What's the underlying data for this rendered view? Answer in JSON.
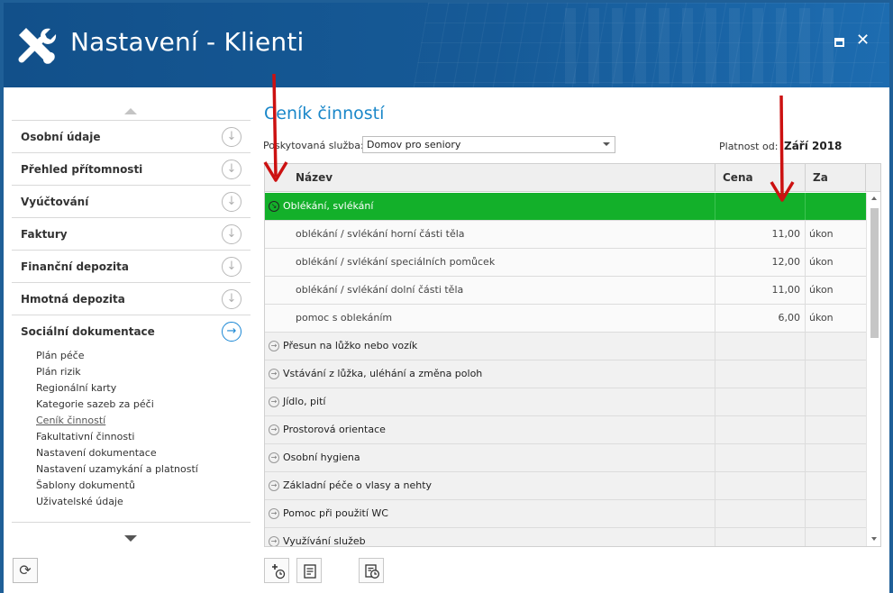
{
  "window": {
    "title": "Nastavení - Klienti",
    "maximize_icon": "maximize-icon",
    "close_label": "✕"
  },
  "sidebar": {
    "items": [
      {
        "label": "Osobní údaje",
        "icon": "circle-arrow-down-icon",
        "active": false
      },
      {
        "label": "Přehled přítomnosti",
        "icon": "circle-arrow-down-icon",
        "active": false
      },
      {
        "label": "Vyúčtování",
        "icon": "circle-arrow-down-icon",
        "active": false
      },
      {
        "label": "Faktury",
        "icon": "circle-arrow-down-icon",
        "active": false
      },
      {
        "label": "Finanční depozita",
        "icon": "circle-arrow-down-icon",
        "active": false
      },
      {
        "label": "Hmotná depozita",
        "icon": "circle-arrow-down-icon",
        "active": false
      },
      {
        "label": "Sociální dokumentace",
        "icon": "circle-arrow-right-icon",
        "active": true
      }
    ],
    "subitems": [
      "Plán péče",
      "Plán rizik",
      "Regionální karty",
      "Kategorie sazeb za péči",
      "Ceník činností",
      "Fakultativní činnosti",
      "Nastavení dokumentace",
      "Nastavení uzamykání a platností",
      "Šablony dokumentů",
      "Uživatelské údaje"
    ],
    "current_subitem": "Ceník činností"
  },
  "main": {
    "title": "Ceník činností",
    "service_label": "Poskytovaná služba:",
    "service_value": "Domov pro seniory",
    "valid_from_label": "Platnost od:",
    "valid_from_value": "Září 2018",
    "columns": {
      "name": "Název",
      "price": "Cena",
      "per": "Za"
    },
    "rows": [
      {
        "type": "category",
        "name": "Oblékání, svlékání",
        "price": "",
        "per": "",
        "selected": true,
        "expanded": true
      },
      {
        "type": "child",
        "name": "oblékání / svlékání horní části těla",
        "price": "11,00",
        "per": "úkon"
      },
      {
        "type": "child",
        "name": "oblékání / svlékání speciálních pomůcek",
        "price": "12,00",
        "per": "úkon"
      },
      {
        "type": "child",
        "name": "oblékání / svlékání dolní části těla",
        "price": "11,00",
        "per": "úkon"
      },
      {
        "type": "child",
        "name": "pomoc s oblekáním",
        "price": "6,00",
        "per": "úkon"
      },
      {
        "type": "category",
        "name": "Přesun na lůžko nebo vozík",
        "price": "",
        "per": ""
      },
      {
        "type": "category",
        "name": "Vstávání z lůžka, uléhání a změna poloh",
        "price": "",
        "per": ""
      },
      {
        "type": "category",
        "name": "Jídlo, pití",
        "price": "",
        "per": ""
      },
      {
        "type": "category",
        "name": "Prostorová orientace",
        "price": "",
        "per": ""
      },
      {
        "type": "category",
        "name": "Osobní hygiena",
        "price": "",
        "per": ""
      },
      {
        "type": "category",
        "name": "Základní péče o vlasy a nehty",
        "price": "",
        "per": ""
      },
      {
        "type": "category",
        "name": "Pomoc při použití WC",
        "price": "",
        "per": ""
      },
      {
        "type": "category",
        "name": "Využívání služeb",
        "price": "",
        "per": ""
      }
    ],
    "toolbar": [
      {
        "name": "add-with-clock-button",
        "icon": "add-clock-icon"
      },
      {
        "name": "detail-button",
        "icon": "document-lines-icon"
      },
      {
        "name": "history-button",
        "icon": "document-clock-icon"
      }
    ]
  },
  "colors": {
    "header": "#165a97",
    "accent": "#1a87c9",
    "selected_row": "#13b02a",
    "annotation_arrow": "#cc1111"
  }
}
